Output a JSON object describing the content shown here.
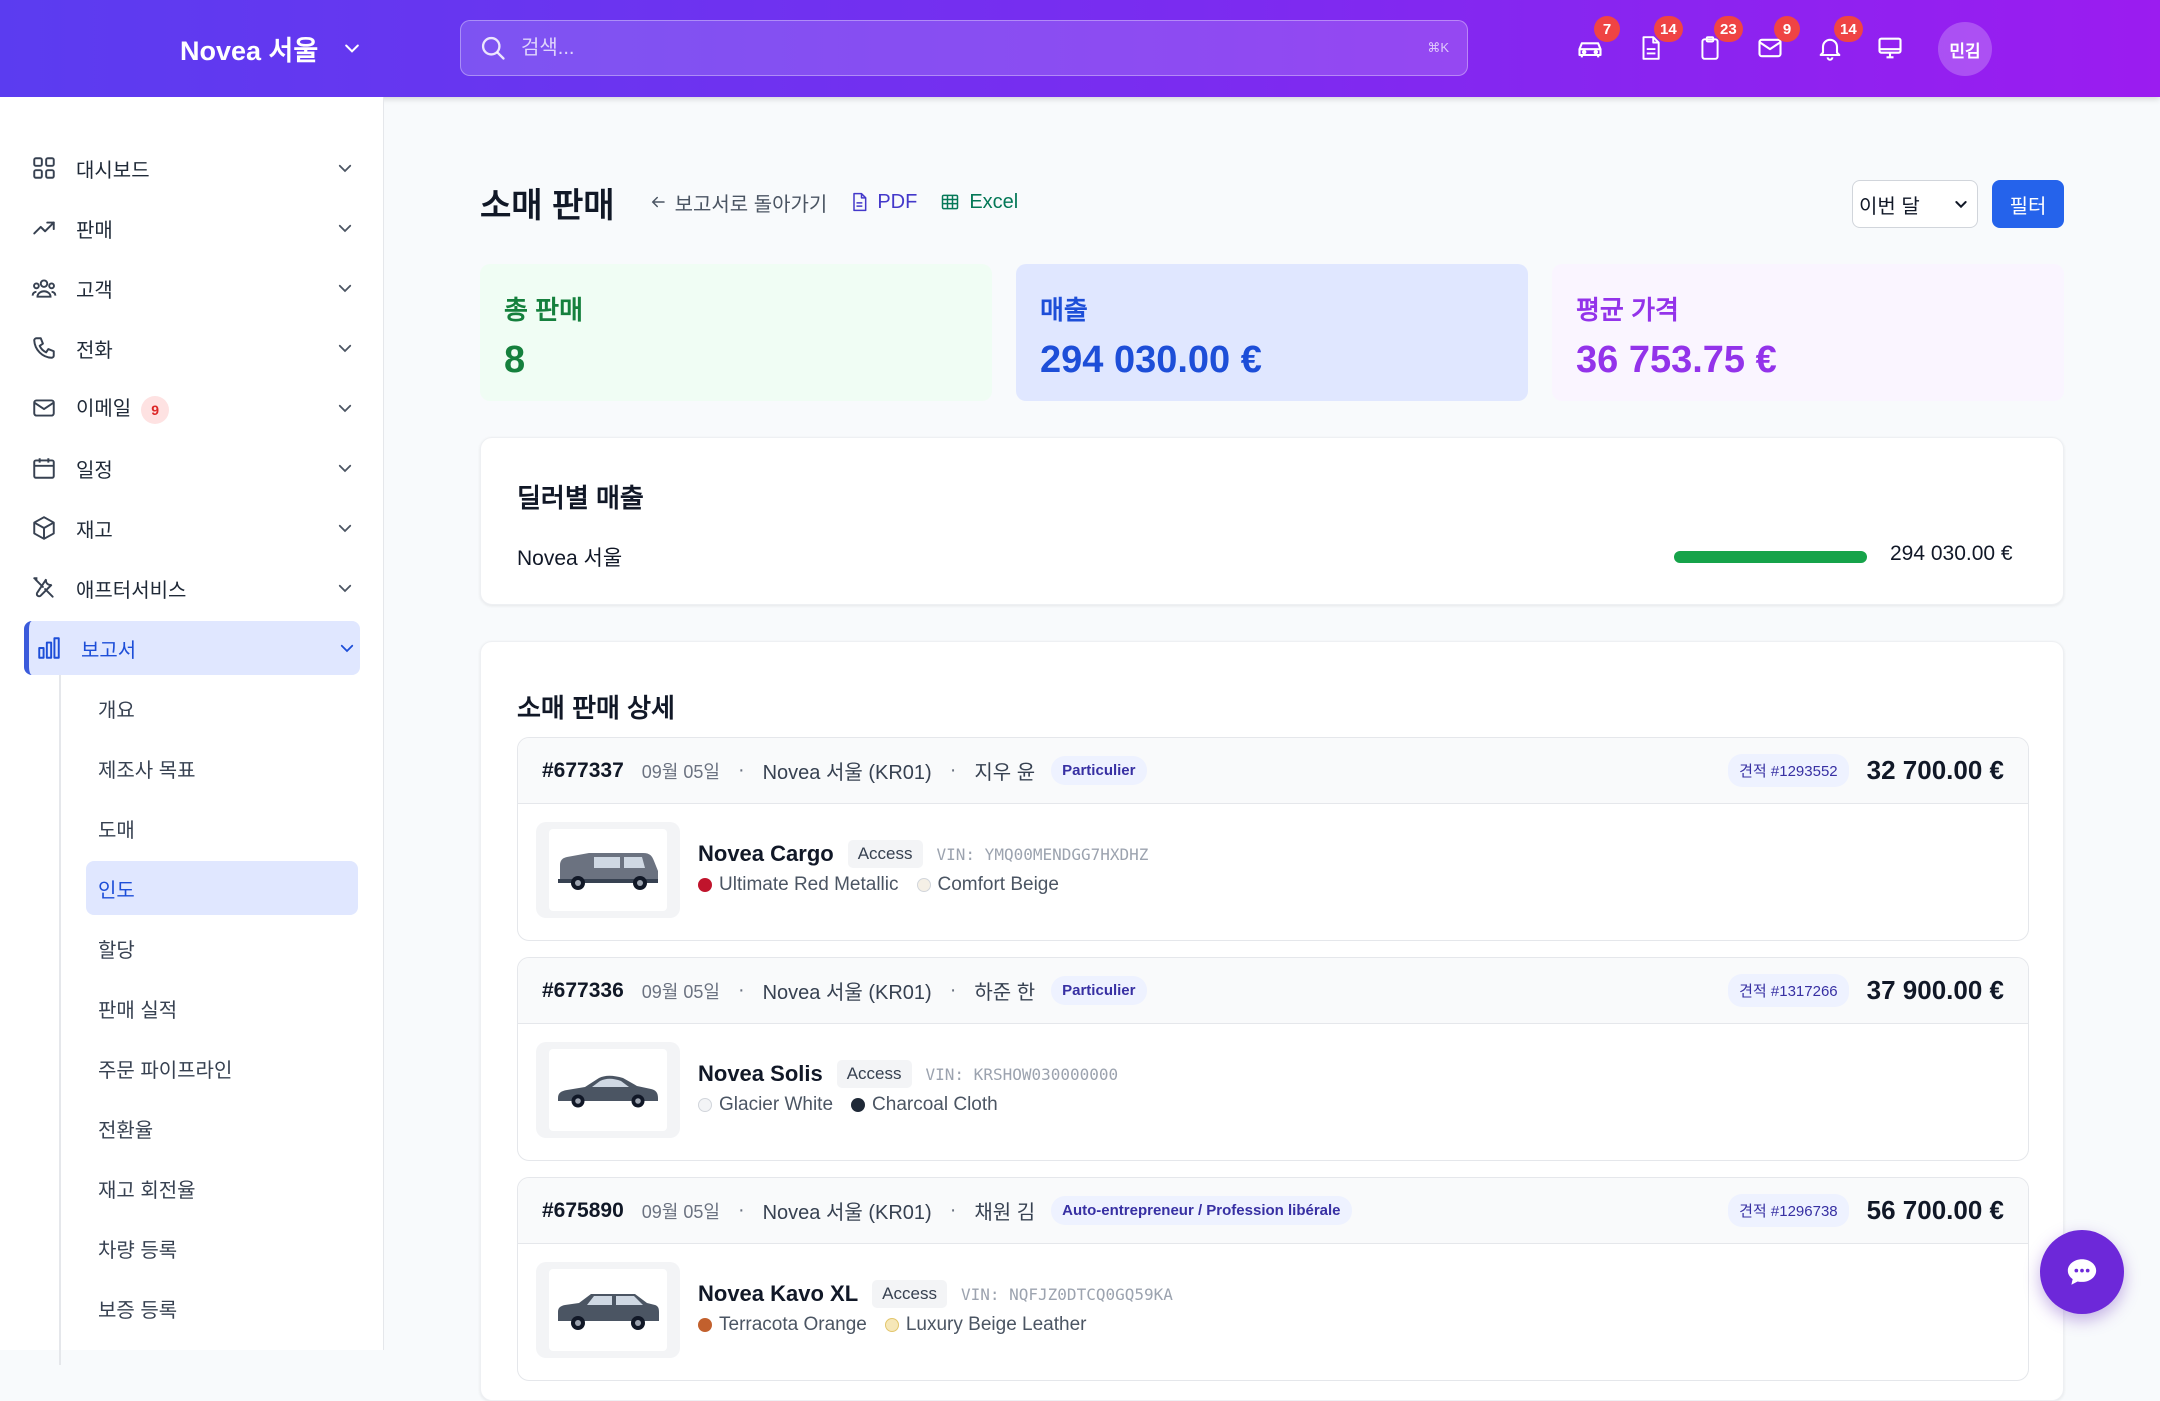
{
  "topbar": {
    "brand": "Novea 서울",
    "search_placeholder": "검색...",
    "search_shortcut": "⌘K",
    "icons": [
      {
        "name": "car-icon",
        "badge": "7"
      },
      {
        "name": "document-icon",
        "badge": "14"
      },
      {
        "name": "clipboard-icon",
        "badge": "23"
      },
      {
        "name": "mail-icon",
        "badge": "9"
      },
      {
        "name": "bell-icon",
        "badge": "14"
      },
      {
        "name": "monitor-icon",
        "badge": ""
      }
    ],
    "avatar": "민김"
  },
  "sidebar": {
    "items": [
      {
        "label": "대시보드",
        "icon": "dashboard-icon"
      },
      {
        "label": "판매",
        "icon": "trending-up-icon"
      },
      {
        "label": "고객",
        "icon": "users-icon"
      },
      {
        "label": "전화",
        "icon": "phone-icon"
      },
      {
        "label": "이메일",
        "icon": "mail-icon",
        "badge": "9"
      },
      {
        "label": "일정",
        "icon": "calendar-icon"
      },
      {
        "label": "재고",
        "icon": "box-icon"
      },
      {
        "label": "애프터서비스",
        "icon": "tools-icon"
      },
      {
        "label": "보고서",
        "icon": "bar-chart-icon",
        "active": true
      }
    ],
    "subitems": [
      "개요",
      "제조사 목표",
      "도매",
      "인도",
      "할당",
      "판매 실적",
      "주문 파이프라인",
      "전환율",
      "재고 회전율",
      "차량 등록",
      "보증 등록"
    ],
    "active_subitem": "인도"
  },
  "page": {
    "title": "소매 판매",
    "back_label": "보고서로 돌아가기",
    "pdf_label": "PDF",
    "excel_label": "Excel",
    "period": "이번 달",
    "filter_label": "필터"
  },
  "stats": [
    {
      "label": "총 판매",
      "value": "8"
    },
    {
      "label": "매출",
      "value": "294 030.00 €"
    },
    {
      "label": "평균 가격",
      "value": "36 753.75 €"
    }
  ],
  "dealer_card": {
    "title": "딜러별 매출",
    "rows": [
      {
        "name": "Novea 서울",
        "value": "294 030.00 €",
        "share": 1.0
      }
    ]
  },
  "detail_card": {
    "title": "소매 판매 상세",
    "sales": [
      {
        "id": "#677337",
        "date": "09월 05일",
        "dealer": "Novea 서울 (KR01)",
        "customer": "지우 윤",
        "customer_type": "Particulier",
        "quote": "견적 #1293552",
        "price": "32 700.00 €",
        "model": "Novea Cargo",
        "trim": "Access",
        "vin": "VIN: YMQ00MENDGG7HXDHZ",
        "exterior": "Ultimate Red Metallic",
        "exterior_color": "#c0142c",
        "interior": "Comfort Beige",
        "interior_color": "#f5f0e6",
        "vehicle": "van"
      },
      {
        "id": "#677336",
        "date": "09월 05일",
        "dealer": "Novea 서울 (KR01)",
        "customer": "하준 한",
        "customer_type": "Particulier",
        "quote": "견적 #1317266",
        "price": "37 900.00 €",
        "model": "Novea Solis",
        "trim": "Access",
        "vin": "VIN: KRSHOW030000000",
        "exterior": "Glacier White",
        "exterior_color": "#f3f4f6",
        "interior": "Charcoal Cloth",
        "interior_color": "#1f2937",
        "vehicle": "sedan"
      },
      {
        "id": "#675890",
        "date": "09월 05일",
        "dealer": "Novea 서울 (KR01)",
        "customer": "채원 김",
        "customer_type": "Auto-entrepreneur / Profession libérale",
        "quote": "견적 #1296738",
        "price": "56 700.00 €",
        "model": "Novea Kavo XL",
        "trim": "Access",
        "vin": "VIN: NQFJZ0DTCQ0GQ59KA",
        "exterior": "Terracota Orange",
        "exterior_color": "#c2602d",
        "interior": "Luxury Beige Leather",
        "interior_color": "#f6e7b8",
        "vehicle": "suv"
      }
    ]
  },
  "chat_button": "chat-bubble-icon"
}
